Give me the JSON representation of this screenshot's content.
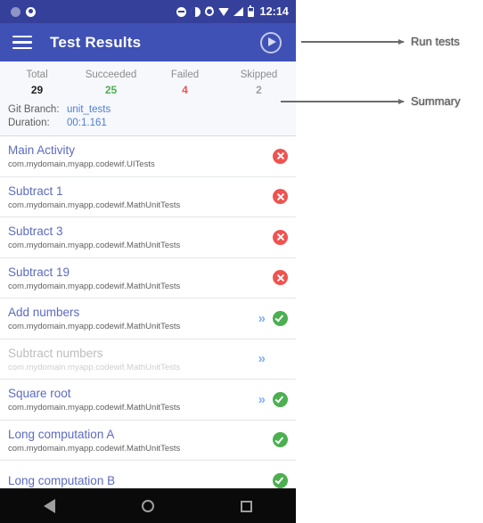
{
  "status_bar": {
    "time": "12:14",
    "icons": [
      "circle-grey-icon",
      "account-circle-icon",
      "do-not-disturb-icon",
      "vibrate-icon",
      "alarm-icon",
      "wifi-icon",
      "cell-signal-icon",
      "battery-icon"
    ]
  },
  "app_bar": {
    "menu_icon": "hamburger-menu-icon",
    "title": "Test Results",
    "run_icon": "play-circle-icon"
  },
  "summary": {
    "stats": [
      {
        "label": "Total",
        "value": "29",
        "color": "#212121"
      },
      {
        "label": "Succeeded",
        "value": "25",
        "color": "#4caf50"
      },
      {
        "label": "Failed",
        "value": "4",
        "color": "#ef5350"
      },
      {
        "label": "Skipped",
        "value": "2",
        "color": "#9e9e9e"
      }
    ],
    "meta": [
      {
        "key": "Git Branch:",
        "value": "unit_tests"
      },
      {
        "key": "Duration:",
        "value": "00:1.161"
      }
    ]
  },
  "tests": [
    {
      "name": "Main Activity",
      "package": "com.mydomain.myapp.codewif.UITests",
      "status": "fail",
      "chevron": false
    },
    {
      "name": "Subtract 1",
      "package": "com.mydomain.myapp.codewif.MathUnitTests",
      "status": "fail",
      "chevron": false
    },
    {
      "name": "Subtract 3",
      "package": "com.mydomain.myapp.codewif.MathUnitTests",
      "status": "fail",
      "chevron": false
    },
    {
      "name": "Subtract 19",
      "package": "com.mydomain.myapp.codewif.MathUnitTests",
      "status": "fail",
      "chevron": false
    },
    {
      "name": "Add numbers",
      "package": "com.mydomain.myapp.codewif.MathUnitTests",
      "status": "pass",
      "chevron": true
    },
    {
      "name": "Subtract numbers",
      "package": "com.mydomain.myapp.codewif.MathUnitTests",
      "status": "skipped",
      "chevron": true
    },
    {
      "name": "Square root",
      "package": "com.mydomain.myapp.codewif.MathUnitTests",
      "status": "pass",
      "chevron": true
    },
    {
      "name": "Long computation A",
      "package": "com.mydomain.myapp.codewif.MathUnitTests",
      "status": "pass",
      "chevron": false
    },
    {
      "name": "Long computation B",
      "package": "",
      "status": "pass",
      "chevron": false
    }
  ],
  "nav_bar": {
    "back_icon": "back-triangle-icon",
    "home_icon": "home-circle-icon",
    "recents_icon": "recents-square-icon"
  },
  "annotations": [
    {
      "label": "Run tests"
    },
    {
      "label": "Summary"
    }
  ],
  "colors": {
    "app_bar": "#3f51b5",
    "status_bar": "#35409a",
    "pass": "#4caf50",
    "fail": "#ef5350",
    "link": "#5c6bc0",
    "chevron": "#82aef0"
  }
}
